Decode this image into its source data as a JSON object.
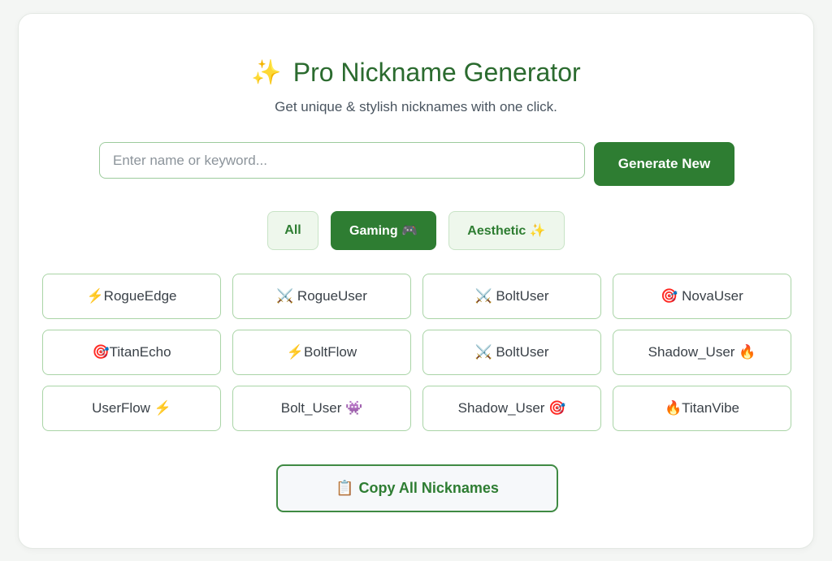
{
  "header": {
    "title_icon": "✨",
    "title": "Pro Nickname Generator",
    "subtitle": "Get unique & stylish nicknames with one click."
  },
  "search": {
    "placeholder": "Enter name or keyword...",
    "value": ""
  },
  "generate_button": {
    "label": "Generate New"
  },
  "filters": [
    {
      "label": "All",
      "active": false
    },
    {
      "label": "Gaming 🎮",
      "active": true
    },
    {
      "label": "Aesthetic ✨",
      "active": false
    }
  ],
  "nicknames": [
    "⚡RogueEdge",
    "⚔️ RogueUser",
    "⚔️ BoltUser",
    "🎯 NovaUser",
    "🎯TitanEcho",
    "⚡BoltFlow",
    "⚔️ BoltUser",
    "Shadow_User 🔥",
    "UserFlow ⚡",
    "Bolt_User 👾",
    "Shadow_User 🎯",
    "🔥TitanVibe"
  ],
  "copy_button": {
    "icon": "📋",
    "label": "Copy All Nicknames"
  },
  "colors": {
    "accent": "#2e7d32",
    "border": "#a9d4a6",
    "title": "#2b6b2f"
  }
}
